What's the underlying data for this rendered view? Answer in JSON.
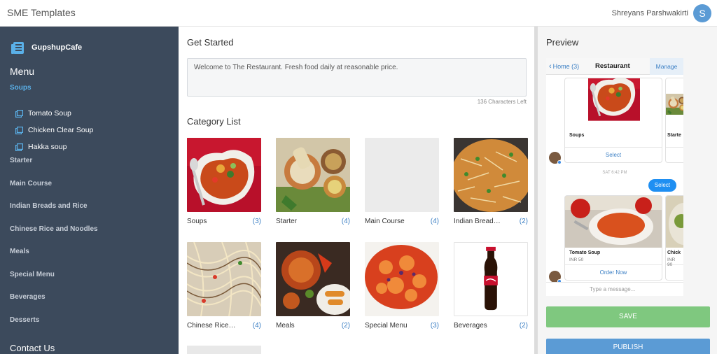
{
  "header": {
    "app_title": "SME Templates",
    "user_name": "Shreyans Parshwakirti",
    "avatar_letter": "S"
  },
  "sidebar": {
    "brand": "GupshupCafe",
    "menu_heading": "Menu",
    "selected_category": "Soups",
    "sub_items": [
      {
        "label": "Tomato Soup"
      },
      {
        "label": "Chicken Clear Soup"
      },
      {
        "label": "Hakka soup"
      }
    ],
    "categories": [
      {
        "label": "Starter"
      },
      {
        "label": "Main Course"
      },
      {
        "label": "Indian Breads and Rice"
      },
      {
        "label": "Chinese Rice and Noodles"
      },
      {
        "label": "Meals"
      },
      {
        "label": "Special Menu"
      },
      {
        "label": "Beverages"
      },
      {
        "label": "Desserts"
      }
    ],
    "contact_heading": "Contact Us"
  },
  "main": {
    "get_started_title": "Get Started",
    "welcome_text": "Welcome to The Restaurant. Fresh food daily at reasonable price.",
    "chars_left": "136 Characters Left",
    "category_list_title": "Category List",
    "cards": [
      {
        "name": "Soups",
        "count": "(3)",
        "image": "soup"
      },
      {
        "name": "Starter",
        "count": "(4)",
        "image": "starter"
      },
      {
        "name": "Main Course",
        "count": "(4)",
        "image": "blank"
      },
      {
        "name": "Indian Bread…",
        "count": "(2)",
        "image": "rice"
      },
      {
        "name": "Chinese Rice…",
        "count": "(4)",
        "image": "noodles"
      },
      {
        "name": "Meals",
        "count": "(2)",
        "image": "meals"
      },
      {
        "name": "Special Menu",
        "count": "(3)",
        "image": "special"
      },
      {
        "name": "Beverages",
        "count": "(2)",
        "image": "cola"
      }
    ]
  },
  "preview": {
    "title": "Preview",
    "back_label": "Home (3)",
    "chat_title": "Restaurant",
    "manage_label": "Manage",
    "card1_title": "Soups",
    "card1_partial_title": "Starte",
    "card1_button": "Select",
    "timestamp": "SAT 6:42 PM",
    "user_bubble": "Select",
    "card2_title": "Tomato Soup",
    "card2_sub": "INR 50",
    "card2_partial_title": "Chick",
    "card2_partial_sub": "INR 90",
    "card2_button": "Order Now",
    "type_placeholder": "Type a message...",
    "save_label": "SAVE",
    "publish_label": "PUBLISH"
  },
  "colors": {
    "sidebar_bg": "#3c4a5c",
    "accent_blue": "#5b9bd5",
    "link_blue": "#3b7fc4",
    "save_green": "#7fc87f"
  }
}
